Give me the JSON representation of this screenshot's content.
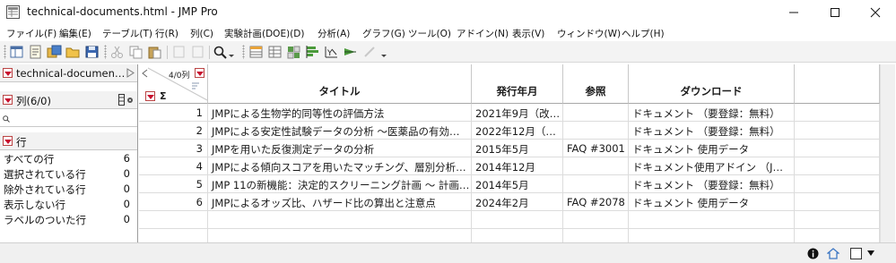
{
  "window": {
    "title": "technical-documents.html - JMP Pro"
  },
  "menu": [
    "ファイル(F)",
    "編集(E)",
    "テーブル(T)",
    "行(R)",
    "列(C)",
    "実験計画(DOE)(D)",
    "分析(A)",
    "グラフ(G)",
    "ツール(O)",
    "アドイン(N)",
    "表示(V)",
    "ウィンドウ(W)",
    "ヘルプ(H)"
  ],
  "toolbar": {
    "icons": [
      "new-table-icon",
      "new-script-icon",
      "new-project-icon",
      "open-icon",
      "save-icon",
      "cut-icon",
      "copy-icon",
      "paste-icon",
      "undo-icon",
      "redo-icon",
      "search-icon",
      "data-grid-icon",
      "tabulate-icon",
      "graph-builder-icon",
      "distribution-icon",
      "fit-xy-icon",
      "fit-model-icon",
      "pen-icon"
    ]
  },
  "left_panel": {
    "table_name": "technical-documen…",
    "columns_label": "列(6/0)",
    "rows_label": "行",
    "row_states": [
      {
        "label": "すべての行",
        "count": "6"
      },
      {
        "label": "選択されている行",
        "count": "0"
      },
      {
        "label": "除外されている行",
        "count": "0"
      },
      {
        "label": "表示しない行",
        "count": "0"
      },
      {
        "label": "ラベルのついた行",
        "count": "0"
      }
    ]
  },
  "grid": {
    "col_count": "4/0列",
    "sigma": "Σ",
    "headers": [
      "タイトル",
      "発行年月",
      "参照",
      "ダウンロード"
    ],
    "rows": [
      {
        "n": "1",
        "cells": [
          "JMPによる生物学的同等性の評価方法",
          "2021年9月（改…",
          "",
          "ドキュメント （要登録：無料）"
        ]
      },
      {
        "n": "2",
        "cells": [
          "JMPによる安定性試験データの分析 ～医薬品の有効…",
          "2022年12月（…",
          "",
          "ドキュメント （要登録：無料）"
        ]
      },
      {
        "n": "3",
        "cells": [
          "JMPを用いた反復測定データの分析",
          "2015年5月",
          "FAQ #3001",
          "ドキュメント 使用データ"
        ]
      },
      {
        "n": "4",
        "cells": [
          "JMPによる傾向スコアを用いたマッチング、層別分析…",
          "2014年12月",
          "",
          "ドキュメント使用アドイン （J…"
        ]
      },
      {
        "n": "5",
        "cells": [
          "JMP 11の新機能：決定的スクリーニング計画 ～ 計画…",
          "2014年5月",
          "",
          "ドキュメント （要登録：無料）"
        ]
      },
      {
        "n": "6",
        "cells": [
          "JMPによるオッズ比、ハザード比の算出と注意点",
          "2024年2月",
          "FAQ #2078",
          "ドキュメント 使用データ"
        ]
      }
    ]
  },
  "colors": {
    "red_triangle": "#c8102e",
    "header_border": "#a8a8a8",
    "toolbar_bg": "#f3f3f3"
  }
}
